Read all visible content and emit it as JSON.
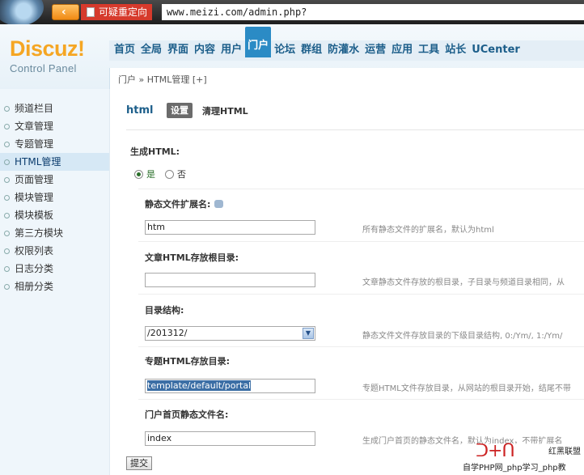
{
  "browser": {
    "redirect_tag": "可疑重定向",
    "url": "www.meizi.com/admin.php?"
  },
  "logo": {
    "title": "Discuz!",
    "subtitle": "Control Panel"
  },
  "nav": [
    "首页",
    "全局",
    "界面",
    "内容",
    "用户",
    "门户",
    "论坛",
    "群组",
    "防灌水",
    "运营",
    "应用",
    "工具",
    "站长",
    "UCenter"
  ],
  "nav_active_index": 5,
  "breadcrumb": "门户 » HTML管理 [+]",
  "sidebar": [
    "频道栏目",
    "文章管理",
    "专题管理",
    "HTML管理",
    "页面管理",
    "模块管理",
    "模块模板",
    "第三方模块",
    "权限列表",
    "日志分类",
    "相册分类"
  ],
  "sidebar_active_index": 3,
  "page": {
    "title": "html",
    "tab_settings": "设置",
    "tab_clear": "清理HTML",
    "gen_html_label": "生成HTML:",
    "radio_yes": "是",
    "radio_no": "否"
  },
  "fields": [
    {
      "label": "静态文件扩展名:",
      "value": "htm",
      "hint": "所有静态文件的扩展名，默认为html"
    },
    {
      "label": "文章HTML存放根目录:",
      "value": "",
      "hint": "文章静态文件存放的根目录，子目录与频道目录相同，从"
    },
    {
      "label": "目录结构:",
      "value": "/201312/",
      "hint": "静态文件文件存放目录的下级目录结构, 0:/Ym/, 1:/Ym/"
    },
    {
      "label": "专题HTML存放目录:",
      "value": "template/default/portal",
      "hint": "专题HTML文件存放目录，从网站的根目录开始，结尾不带"
    },
    {
      "label": "门户首页静态文件名:",
      "value": "index",
      "hint": "生成门户首页的静态文件名，默认为index，不带扩展名"
    }
  ],
  "submit_label": "提交",
  "watermark": {
    "side": "红黑联盟",
    "caption": "自学PHP网_php学习_php教"
  }
}
